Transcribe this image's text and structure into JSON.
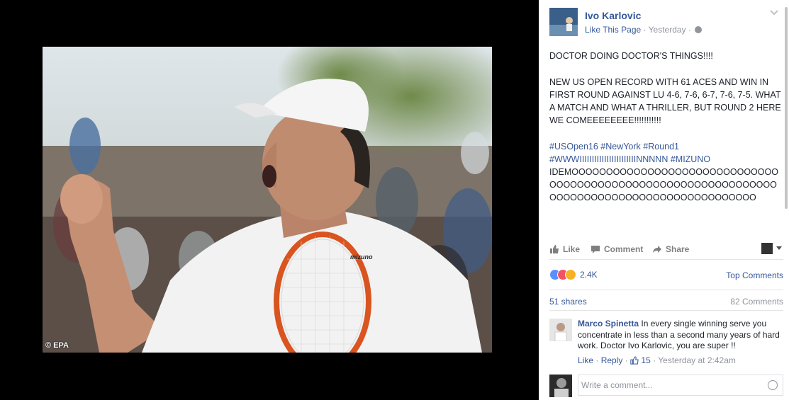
{
  "photo": {
    "credit": "© EPA",
    "racket_brand": "mizuno"
  },
  "post": {
    "page_name": "Ivo Karlovic",
    "like_page": "Like This Page",
    "separator": "·",
    "time": "Yesterday",
    "separator2": "·",
    "text": {
      "line1": "DOCTOR DOING DOCTOR'S THINGS!!!!",
      "line2": "NEW US OPEN RECORD WITH 61 ACES AND WIN IN FIRST ROUND AGAINST LU 4-6, 7-6, 6-7, 7-6, 7-5. WHAT A MATCH AND WHAT A THRILLER, BUT ROUND 2 HERE WE COMEEEEEEEE!!!!!!!!!!!",
      "hashtags": "#USOpen16 #NewYork #Round1 #WWWIIIIIIIIIIIIIIIIIIIIIIINNNNN #MIZUNO",
      "idemo": "IDEMOOOOOOOOOOOOOOOOOOOOOOOOOOOOOOOOOOOOOOOOOOOOOOOOOOOOOOOOOOOOOOOOOOOOOOOOOOOOOOOOOOOOOOOOOOOOO"
    }
  },
  "actions": {
    "like": "Like",
    "comment": "Comment",
    "share": "Share"
  },
  "stats": {
    "reactions": "2.4K",
    "top_comments": "Top Comments",
    "shares": "51 shares",
    "comments": "82 Comments"
  },
  "comment": {
    "author": "Marco Spinetta",
    "text": "In every single winning serve you concentrate in less than a second many years of hard work. Doctor Ivo Karlovic, you are super !!",
    "like": "Like",
    "dot": "·",
    "reply": "Reply",
    "dot2": "·",
    "likes": "15",
    "dot3": "·",
    "time": "Yesterday at 2:42am"
  },
  "compose": {
    "placeholder": "Write a comment..."
  },
  "colors": {
    "link": "#365899",
    "muted": "#90949c",
    "text": "#1d2129"
  }
}
